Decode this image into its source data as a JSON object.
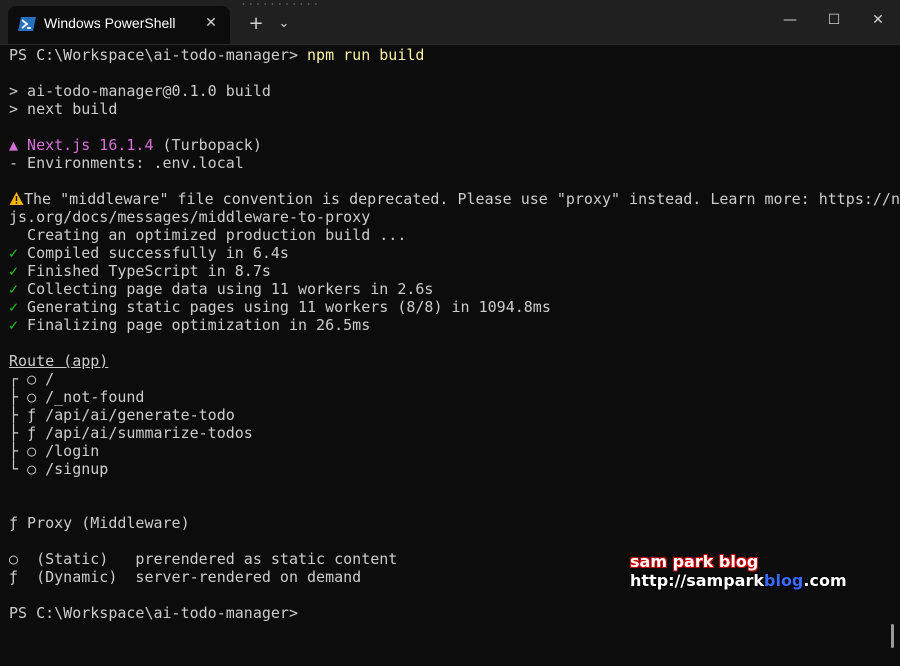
{
  "window": {
    "tab_title": "Windows PowerShell",
    "tab_close": "✕",
    "new_tab": "+",
    "dropdown": "⌄",
    "minimize": "—",
    "maximize": "☐",
    "close": "✕",
    "background_text": "...........",
    "icon": "powershell-icon"
  },
  "terminal": {
    "prompt_cmd_prefix": "PS C:\\Workspace\\ai-todo-manager> ",
    "prompt_cmd": "npm run build",
    "script_line1": "> ai-todo-manager@0.1.0 build",
    "script_line2": "> next build",
    "nextjs_label": "▲ Next.js 16.1.4",
    "nextjs_suffix": " (Turbopack)",
    "env_line": "- Environments: .env.local",
    "warning_line1": "The \"middleware\" file convention is deprecated. Please use \"proxy\" instead. Learn more: https://next",
    "warning_line2": "js.org/docs/messages/middleware-to-proxy",
    "creating_line": "  Creating an optimized production build ...",
    "check_mark": "✓",
    "steps": [
      " Compiled successfully in 6.4s",
      " Finished TypeScript in 8.7s",
      " Collecting page data using 11 workers in 2.6s",
      " Generating static pages using 11 workers (8/8) in 1094.8ms",
      " Finalizing page optimization in 26.5ms"
    ],
    "route_header": "Route (app)",
    "routes": [
      {
        "prefix": "┌ ",
        "symbol": "○",
        "path": " /"
      },
      {
        "prefix": "├ ",
        "symbol": "○",
        "path": " /_not-found"
      },
      {
        "prefix": "├ ",
        "symbol": "ƒ",
        "path": " /api/ai/generate-todo"
      },
      {
        "prefix": "├ ",
        "symbol": "ƒ",
        "path": " /api/ai/summarize-todos"
      },
      {
        "prefix": "├ ",
        "symbol": "○",
        "path": " /login"
      },
      {
        "prefix": "└ ",
        "symbol": "○",
        "path": " /signup"
      }
    ],
    "proxy_line": "ƒ Proxy (Middleware)",
    "legend_static": "○  (Static)   prerendered as static content",
    "legend_dynamic": "ƒ  (Dynamic)  server-rendered on demand",
    "final_prompt": "PS C:\\Workspace\\ai-todo-manager>"
  },
  "watermark": {
    "line1": "sam park blog",
    "line2_a": "http://sampark",
    "line2_b": "blog",
    "line2_c": ".com"
  },
  "colors": {
    "background": "#0c0c0c",
    "command": "#f9f1a5",
    "nextjs": "#d670d6",
    "success": "#16c60c",
    "text": "#cccccc"
  }
}
